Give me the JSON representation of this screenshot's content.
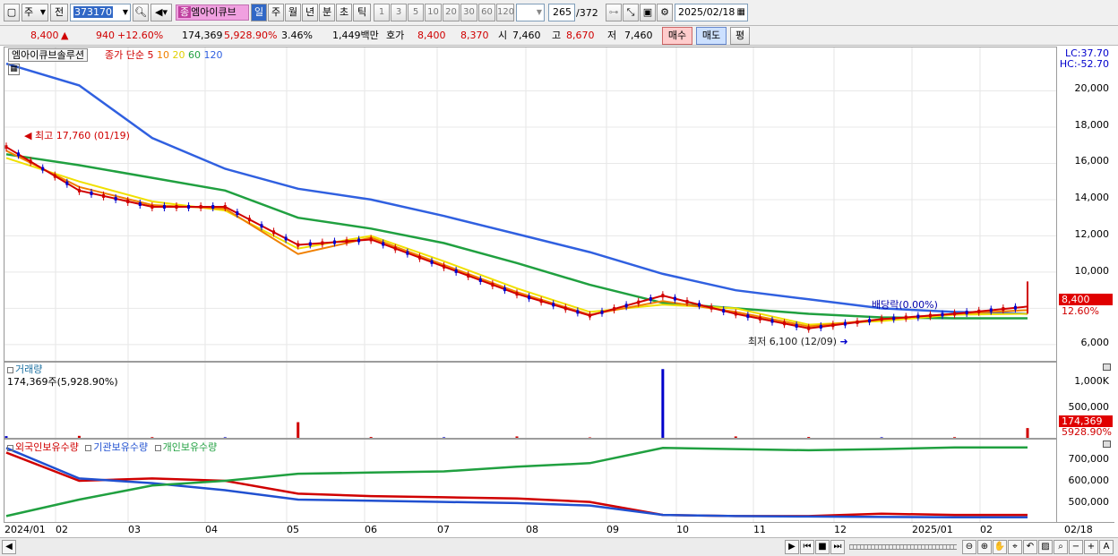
{
  "toolbar": {
    "market": "주",
    "prev": "전",
    "code": "373170",
    "stock_tag": "종",
    "stock_name": "엠아이큐브",
    "periods": [
      "일",
      "주",
      "월",
      "년",
      "분",
      "초",
      "틱"
    ],
    "intervals": [
      "1",
      "3",
      "5",
      "10",
      "20",
      "30",
      "60",
      "120"
    ],
    "page_count": "265",
    "page_total": "/372",
    "date": "2025/02/18"
  },
  "info": {
    "price": "8,400",
    "change": "940",
    "change_pct": "+12.60%",
    "volume": "174,369",
    "volume_pct": "5,928.90%",
    "turnover": "3.46%",
    "amount": "1,449백만",
    "quote_label": "호가",
    "quote_bid": "8,400",
    "quote_ask": "8,370",
    "open_label": "시",
    "open": "7,460",
    "high_label": "고",
    "high": "8,670",
    "low_label": "저",
    "low": "7,460",
    "buy_label": "매수",
    "sell_label": "매도",
    "eval_label": "평"
  },
  "price_panel": {
    "stock_label": "엠아이큐브솔루션",
    "legend_prefix": "종가 단순",
    "ma_labels": [
      "5",
      "10",
      "20",
      "60",
      "120"
    ],
    "lc": "LC:37.70",
    "hc": "HC:-52.70",
    "y_ticks": [
      "20,000",
      "18,000",
      "16,000",
      "14,000",
      "12,000",
      "10,000",
      "6,000"
    ],
    "high_note": "최고 17,760 (01/19)",
    "low_note": "최저 6,100 (12/09)",
    "dividend_note": "배당락(0.00%)",
    "last_price_tag": "8,400",
    "last_pct_tag": "12.60%"
  },
  "volume_panel": {
    "title": "거래량",
    "value": "174,369주(5,928.90%)",
    "y_ticks": [
      "1,000K",
      "500,000"
    ],
    "last_tag": "174,369",
    "last_pct_tag": "5928.90%"
  },
  "holding_panel": {
    "legend": [
      "외국인보유수량",
      "기관보유수량",
      "개인보유수량"
    ],
    "y_ticks": [
      "700,000",
      "600,000",
      "500,000"
    ]
  },
  "x_labels": [
    "2024/01",
    "02",
    "03",
    "04",
    "05",
    "06",
    "07",
    "08",
    "09",
    "10",
    "11",
    "12",
    "2025/01",
    "02"
  ],
  "x_end_label": "02/18",
  "colors": {
    "up": "#d00000",
    "down": "#0000cc",
    "ma5": "#d00000",
    "ma10": "#f08000",
    "ma20": "#f0e000",
    "ma60": "#20a040",
    "ma120": "#3060e0"
  },
  "chart_data": [
    {
      "type": "line",
      "title": "",
      "x": [
        "2024/01",
        "02",
        "03",
        "04",
        "05",
        "06",
        "07",
        "08",
        "09",
        "10",
        "11",
        "12",
        "2025/01",
        "02",
        "02/18"
      ],
      "series": [
        {
          "name": "5",
          "values": [
            16900,
            14500,
            13600,
            13600,
            11500,
            11800,
            10300,
            8800,
            7600,
            8700,
            7700,
            6900,
            7400,
            7700,
            8100
          ]
        },
        {
          "name": "10",
          "values": [
            16700,
            14700,
            13700,
            13500,
            11000,
            11900,
            10400,
            8900,
            7650,
            8400,
            7800,
            7000,
            7400,
            7700,
            7900
          ]
        },
        {
          "name": "20",
          "values": [
            16300,
            15000,
            13900,
            13400,
            11300,
            12000,
            10600,
            9100,
            7800,
            8200,
            8000,
            7100,
            7300,
            7650,
            7700
          ]
        },
        {
          "name": "60",
          "values": [
            16500,
            15900,
            15200,
            14500,
            13000,
            12400,
            11600,
            10500,
            9300,
            8300,
            8000,
            7700,
            7500,
            7450,
            7450
          ]
        },
        {
          "name": "120",
          "values": [
            21500,
            20300,
            17400,
            15700,
            14600,
            14000,
            13100,
            12100,
            11100,
            9900,
            9000,
            8500,
            8000,
            7800,
            7700
          ]
        }
      ],
      "ylim": [
        5500,
        22000
      ],
      "annotations": [
        "최고 17,760 (01/19)",
        "최저 6,100 (12/09)",
        "배당락(0.00%)"
      ]
    },
    {
      "type": "bar",
      "title": "",
      "categories": [
        "2024/01",
        "02",
        "03",
        "04",
        "05",
        "06",
        "07",
        "08",
        "09",
        "10",
        "11",
        "12",
        "2025/01",
        "02",
        "02/18"
      ],
      "values": [
        30000,
        35000,
        12000,
        10000,
        280000,
        15000,
        10000,
        25000,
        8000,
        1230000,
        25000,
        15000,
        10000,
        12000,
        174369
      ],
      "ylim": [
        0,
        1250000
      ]
    },
    {
      "type": "line",
      "title": "",
      "x": [
        "2024/01",
        "02",
        "03",
        "04",
        "05",
        "06",
        "07",
        "08",
        "09",
        "10",
        "11",
        "12",
        "2025/01",
        "02",
        "02/18"
      ],
      "series": [
        {
          "name": "외국인보유수량",
          "values": [
            720000,
            600000,
            610000,
            600000,
            545000,
            535000,
            530000,
            525000,
            510000,
            455000,
            450000,
            450000,
            460000,
            455000,
            455000
          ]
        },
        {
          "name": "기관보유수량",
          "values": [
            740000,
            610000,
            590000,
            560000,
            520000,
            515000,
            510000,
            505000,
            495000,
            455000,
            450000,
            448000,
            446000,
            445000,
            445000
          ]
        },
        {
          "name": "개인보유수량",
          "values": [
            450000,
            520000,
            580000,
            600000,
            630000,
            635000,
            640000,
            660000,
            675000,
            740000,
            735000,
            730000,
            735000,
            742000,
            742000
          ]
        }
      ],
      "ylim": [
        440000,
        760000
      ]
    }
  ]
}
